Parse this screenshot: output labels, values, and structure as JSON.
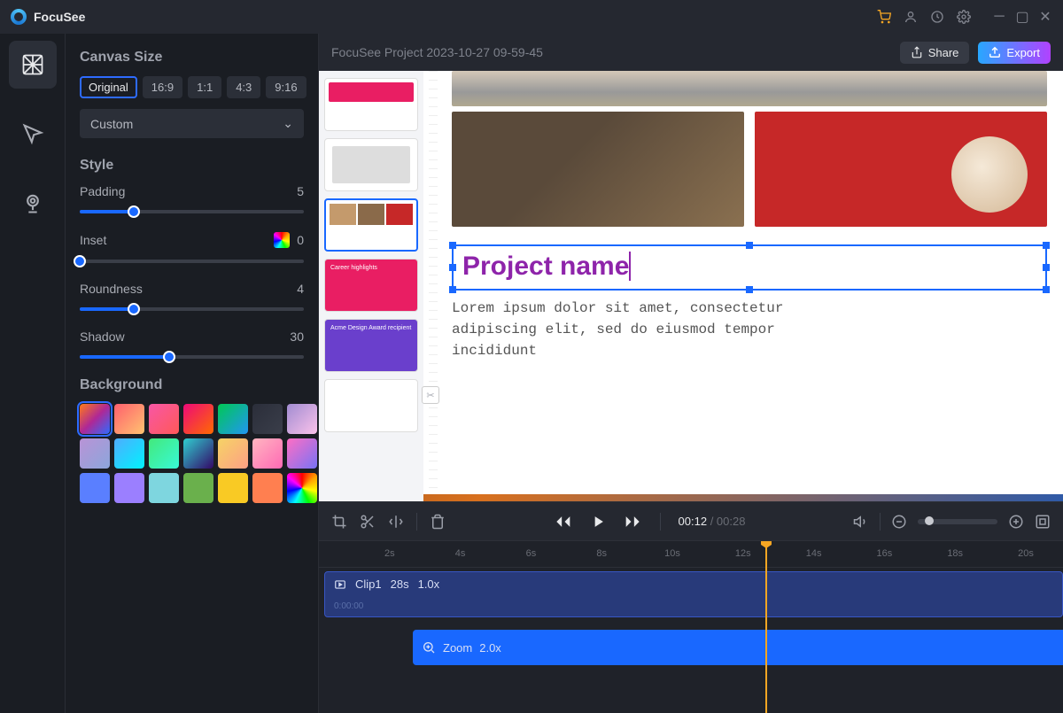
{
  "app": {
    "name": "FocuSee"
  },
  "project": {
    "title": "FocuSee Project 2023-10-27 09-59-45"
  },
  "buttons": {
    "share": "Share",
    "export": "Export"
  },
  "canvas": {
    "section": "Canvas Size",
    "ratios": [
      "Original",
      "16:9",
      "1:1",
      "4:3",
      "9:16"
    ],
    "selected_ratio": "Original",
    "custom_label": "Custom"
  },
  "style": {
    "section": "Style",
    "padding": {
      "label": "Padding",
      "value": 5,
      "pct": 24
    },
    "inset": {
      "label": "Inset",
      "value": 0,
      "pct": 0
    },
    "roundness": {
      "label": "Roundness",
      "value": 4,
      "pct": 24
    },
    "shadow": {
      "label": "Shadow",
      "value": 30,
      "pct": 40
    }
  },
  "background": {
    "section": "Background",
    "swatches": [
      "linear-gradient(135deg,#ff7a18,#af2896,#2e6bff)",
      "linear-gradient(135deg,#ff5f6d,#ffc371)",
      "linear-gradient(135deg,#f857a6,#ff5858)",
      "linear-gradient(135deg,#ee0979,#ff6a00)",
      "linear-gradient(135deg,#00c853,#2196f3)",
      "linear-gradient(135deg,#2b2e3a,#3a3e4a)",
      "linear-gradient(135deg,#a18cd1,#fbc2eb)",
      "linear-gradient(135deg,#b993d6,#8ca6db)",
      "linear-gradient(135deg,#4facfe,#00f2fe)",
      "linear-gradient(135deg,#43e97b,#38f9d7)",
      "linear-gradient(135deg,#30cfd0,#330867)",
      "linear-gradient(135deg,#f6d365,#fda085)",
      "linear-gradient(135deg,#ffb6c1,#ff69b4)",
      "linear-gradient(135deg,#ff6ec4,#7873f5)",
      "#5a7fff",
      "#9b7fff",
      "#7ed6df",
      "#6ab04c",
      "#f9ca24",
      "#ff7f50",
      "conic-gradient(red,orange,yellow,lime,cyan,blue,magenta,red)"
    ],
    "selected": 0
  },
  "preview": {
    "title_text": "Project name",
    "lorem": "Lorem ipsum dolor sit amet, consectetur adipiscing elit, sed do eiusmod tempor incididunt"
  },
  "playback": {
    "current": "00:12",
    "total": "00:28"
  },
  "timeline": {
    "ticks": [
      "2s",
      "4s",
      "6s",
      "8s",
      "10s",
      "12s",
      "14s",
      "16s",
      "18s",
      "20s"
    ],
    "playhead_pct": 60,
    "clip": {
      "name": "Clip1",
      "duration": "28s",
      "speed": "1.0x",
      "ts": "0:00:00"
    },
    "zoom": {
      "label": "Zoom",
      "speed": "2.0x"
    }
  }
}
